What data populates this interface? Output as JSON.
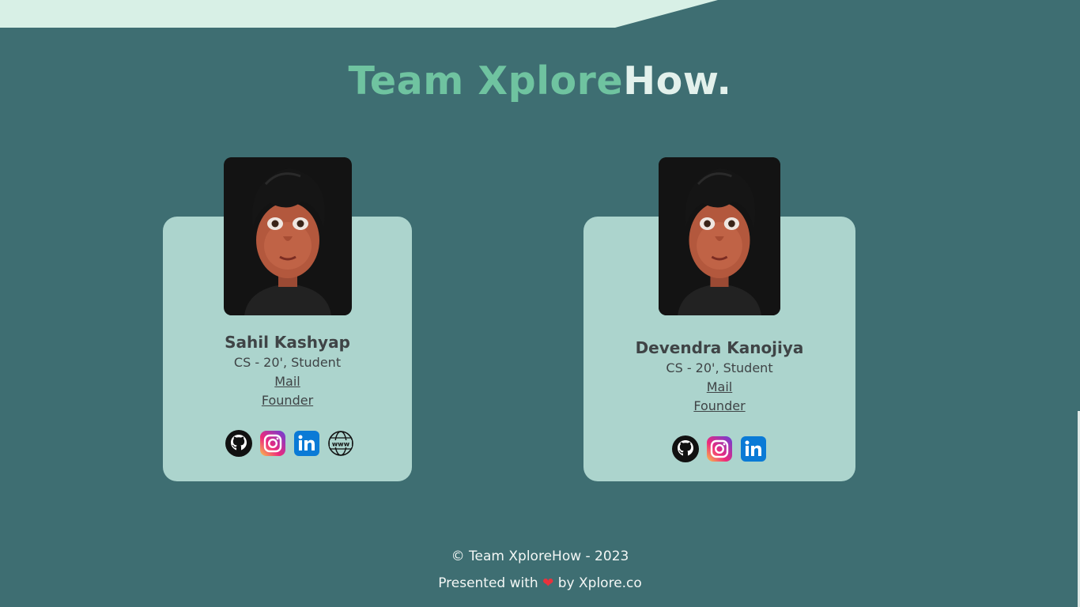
{
  "title": {
    "accent": "Team Xplore",
    "rest": "How."
  },
  "colors": {
    "background": "#3e6e72",
    "accent": "#6fc3a0",
    "card": "#acd4cd",
    "top_band": "#d8f0e6",
    "heart": "#e8323c"
  },
  "members": [
    {
      "name": "Sahil Kashyap",
      "role": "CS - 20', Student",
      "mail_label": "Mail",
      "position_label": "Founder",
      "socials": [
        "github-icon",
        "instagram-icon",
        "linkedin-icon",
        "website-icon"
      ]
    },
    {
      "name": "Devendra Kanojiya",
      "role": "CS - 20', Student",
      "mail_label": "Mail",
      "position_label": "Founder",
      "socials": [
        "github-icon",
        "instagram-icon",
        "linkedin-icon"
      ]
    }
  ],
  "footer": {
    "copyright": "© Team XploreHow - 2023",
    "presented_prefix": "Presented with",
    "heart": "❤",
    "presented_suffix": "by Xplore.co"
  }
}
